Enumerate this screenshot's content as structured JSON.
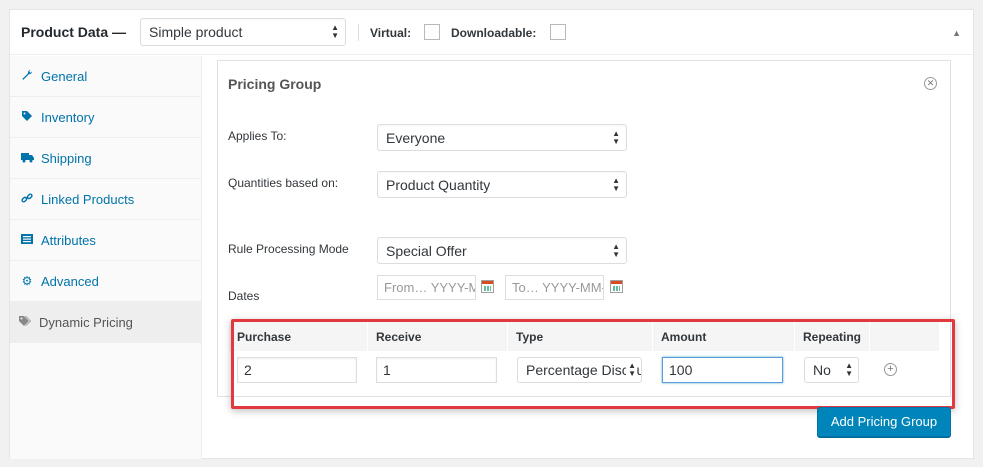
{
  "header": {
    "title": "Product Data —",
    "product_type": "Simple product",
    "virtual_label": "Virtual:",
    "downloadable_label": "Downloadable:",
    "collapse_icon": "triangle-up-icon"
  },
  "sidebar": {
    "items": [
      {
        "label": "General",
        "icon": "wrench-icon"
      },
      {
        "label": "Inventory",
        "icon": "tag-icon"
      },
      {
        "label": "Shipping",
        "icon": "truck-icon"
      },
      {
        "label": "Linked Products",
        "icon": "link-icon"
      },
      {
        "label": "Attributes",
        "icon": "list-icon"
      },
      {
        "label": "Advanced",
        "icon": "gear-icon"
      },
      {
        "label": "Dynamic Pricing",
        "icon": "tags-icon",
        "active": true
      }
    ]
  },
  "pricing_group": {
    "title": "Pricing Group",
    "applies_to_label": "Applies To:",
    "applies_to_value": "Everyone",
    "quantities_label": "Quantities based on:",
    "quantities_value": "Product Quantity",
    "rule_mode_label": "Rule Processing Mode",
    "rule_mode_value": "Special Offer",
    "dates_label": "Dates",
    "date_from_placeholder": "From… YYYY-MM-DD",
    "date_to_placeholder": "To… YYYY-MM-DD"
  },
  "rules_table": {
    "headers": [
      "Purchase",
      "Receive",
      "Type",
      "Amount",
      "Repeating"
    ],
    "row": {
      "purchase": "2",
      "receive": "1",
      "type": "Percentage Discount",
      "amount": "100",
      "repeating": "No"
    }
  },
  "actions": {
    "add_group": "Add Pricing Group"
  },
  "colors": {
    "link": "#0073aa",
    "primary_button": "#0085ba",
    "highlight_border": "#e0393e"
  }
}
